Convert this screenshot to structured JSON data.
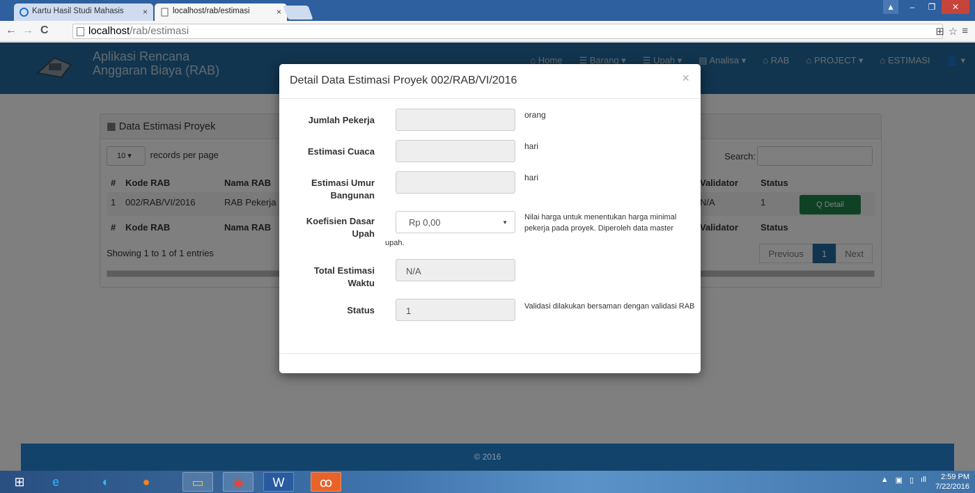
{
  "browser": {
    "tabs": [
      {
        "title": "Kartu Hasil Studi Mahasis",
        "active": false
      },
      {
        "title": "localhost/rab/estimasi",
        "active": true
      }
    ],
    "url_host": "localhost",
    "url_path": "/rab/estimasi"
  },
  "app": {
    "brand": "Aplikasi Rencana Anggaran Biaya (RAB)",
    "nav": [
      "Home",
      "Barang",
      "Upah",
      "Analisa",
      "RAB",
      "PROJECT",
      "ESTIMASI"
    ],
    "accent": "#236b9f"
  },
  "panel": {
    "title": "Data Estimasi Proyek",
    "length_value": "10",
    "length_label": "records per page",
    "search_label": "Search:",
    "columns": [
      "#",
      "Kode RAB",
      "Nama RAB",
      "Validator",
      "Status"
    ],
    "rows": [
      {
        "no": "1",
        "kode": "002/RAB/VI/2016",
        "nama": "RAB Pekerja",
        "validator": "N/A",
        "status": "1"
      }
    ],
    "detail_label": "Q Detail",
    "info": "Showing 1 to 1 of 1 entries",
    "pager": {
      "prev": "Previous",
      "current": "1",
      "next": "Next"
    }
  },
  "modal": {
    "title": "Detail Data Estimasi Proyek 002/RAB/VI/2016",
    "close": "×",
    "fields": [
      {
        "label": "Jumlah Pekerja",
        "value": "",
        "help": "orang"
      },
      {
        "label": "Estimasi Cuaca",
        "value": "",
        "help": "hari"
      },
      {
        "label": "Estimasi Umur Bangunan",
        "value": "",
        "help": "hari"
      },
      {
        "label": "Koefisien Dasar Upah",
        "value": "Rp 0,00",
        "help": "Nilai harga untuk menentukan harga minimal pekerja pada proyek. Diperoleh data master",
        "help_extra": "upah."
      },
      {
        "label": "Total Estimasi Waktu",
        "value": "N/A",
        "help": ""
      },
      {
        "label": "Status",
        "value": "1",
        "help": "Validasi dilakukan bersaman dengan validasi RAB"
      }
    ]
  },
  "footer": "© 2016",
  "clock": {
    "time": "2:59 PM",
    "date": "7/22/2016"
  }
}
